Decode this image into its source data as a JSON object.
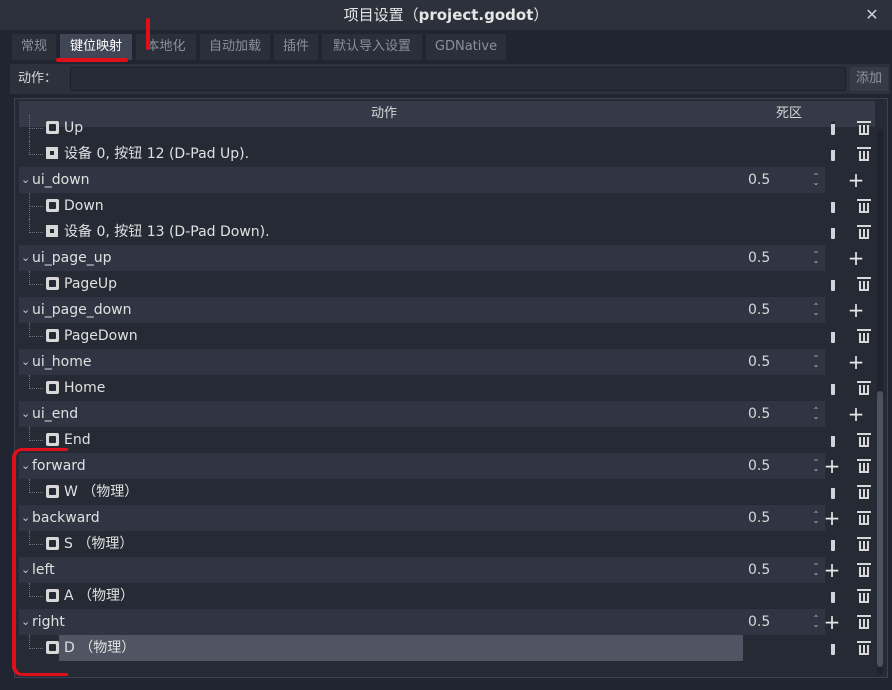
{
  "window": {
    "title_prefix": "项目设置（",
    "title_project": "project.godot",
    "title_suffix": "）"
  },
  "tabs": [
    {
      "label": "常规",
      "active": false
    },
    {
      "label": "键位映射",
      "active": true
    },
    {
      "label": "本地化",
      "active": false
    },
    {
      "label": "自动加载",
      "active": false
    },
    {
      "label": "插件",
      "active": false
    },
    {
      "label": "默认导入设置",
      "active": false
    },
    {
      "label": "GDNative",
      "active": false
    }
  ],
  "toolbar": {
    "action_label": "动作：",
    "action_input_value": "",
    "add_label": "添加"
  },
  "tree_header": {
    "action": "动作",
    "deadzone": "死区"
  },
  "rows": [
    {
      "kind": "child",
      "icon": "key-icon",
      "label": "Up"
    },
    {
      "kind": "child",
      "icon": "joypad-icon",
      "label": "设备 0, 按钮 12 (D-Pad Up)."
    },
    {
      "kind": "parent",
      "label": "ui_down",
      "deadzone": "0.5"
    },
    {
      "kind": "child",
      "icon": "key-icon",
      "label": "Down"
    },
    {
      "kind": "child",
      "icon": "joypad-icon",
      "label": "设备 0, 按钮 13 (D-Pad Down)."
    },
    {
      "kind": "parent",
      "label": "ui_page_up",
      "deadzone": "0.5"
    },
    {
      "kind": "child",
      "icon": "key-icon",
      "label": "PageUp"
    },
    {
      "kind": "parent",
      "label": "ui_page_down",
      "deadzone": "0.5"
    },
    {
      "kind": "child",
      "icon": "key-icon",
      "label": "PageDown"
    },
    {
      "kind": "parent",
      "label": "ui_home",
      "deadzone": "0.5"
    },
    {
      "kind": "child",
      "icon": "key-icon",
      "label": "Home"
    },
    {
      "kind": "parent",
      "label": "ui_end",
      "deadzone": "0.5"
    },
    {
      "kind": "child",
      "icon": "key-icon",
      "label": "End"
    },
    {
      "kind": "parent",
      "label": "forward",
      "deadzone": "0.5"
    },
    {
      "kind": "child",
      "icon": "physical-key-icon",
      "label": "W （物理）"
    },
    {
      "kind": "parent",
      "label": "backward",
      "deadzone": "0.5"
    },
    {
      "kind": "child",
      "icon": "physical-key-icon",
      "label": "S （物理）"
    },
    {
      "kind": "parent",
      "label": "left",
      "deadzone": "0.5"
    },
    {
      "kind": "child",
      "icon": "physical-key-icon",
      "label": "A （物理）"
    },
    {
      "kind": "parent",
      "label": "right",
      "deadzone": "0.5"
    },
    {
      "kind": "child",
      "icon": "physical-key-icon",
      "label": "D （物理）",
      "selected": true
    }
  ],
  "colors": {
    "background": "#202531",
    "panel": "#252a35",
    "parent_row": "#2f3542",
    "selected_row": "#4f5563",
    "annotation": "#e0101a"
  }
}
